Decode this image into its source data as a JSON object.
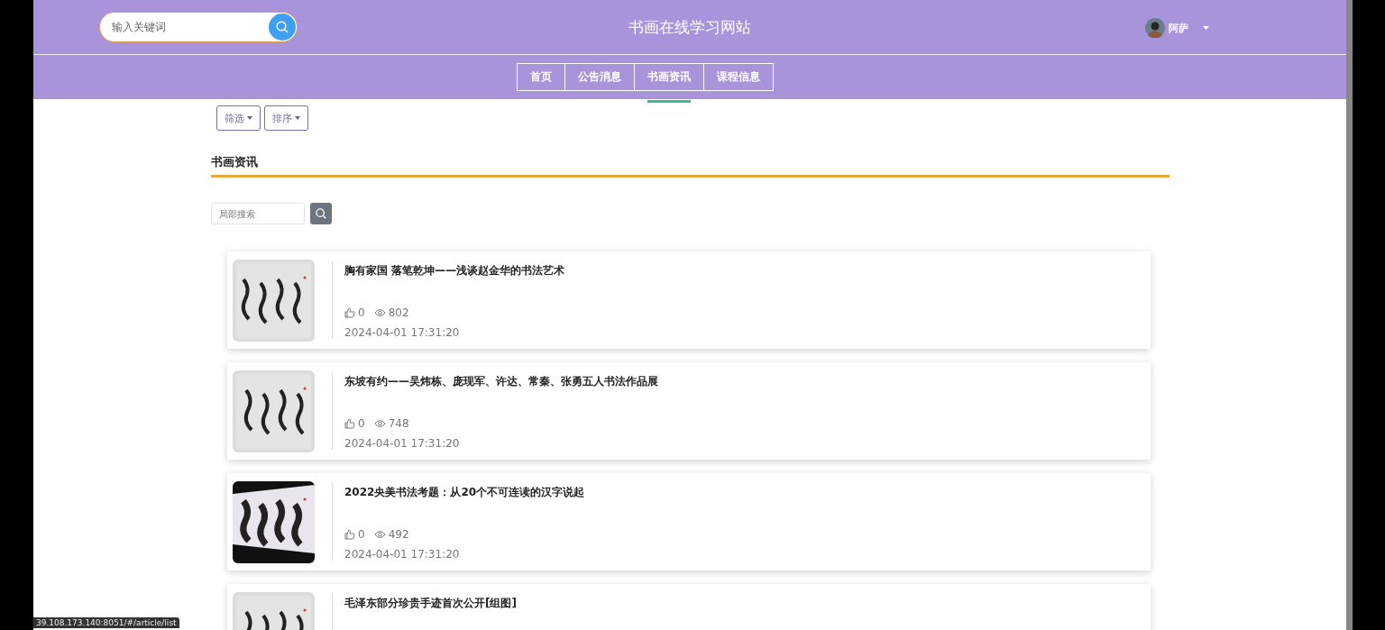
{
  "header": {
    "search": {
      "placeholder": "输入关键词"
    },
    "site_title": "书画在线学习网站",
    "user": {
      "name": "阿萨"
    }
  },
  "nav": {
    "tabs": [
      {
        "label": "首页",
        "selected": false
      },
      {
        "label": "公告消息",
        "selected": false
      },
      {
        "label": "书画资讯",
        "selected": true
      },
      {
        "label": "课程信息",
        "selected": false
      }
    ]
  },
  "toolbar": {
    "buttons": [
      "筛选",
      "排序"
    ]
  },
  "section": {
    "title": "书画资讯",
    "local_search": {
      "placeholder": "局部搜索"
    }
  },
  "articles": [
    {
      "title": "胸有家国 落笔乾坤——浅谈赵金华的书法艺术",
      "likes": "0",
      "views": "802",
      "date": "2024-04-01 17:31:20"
    },
    {
      "title": "东坡有约——吴炜栋、庞现军、许达、常秦、张勇五人书法作品展",
      "likes": "0",
      "views": "748",
      "date": "2024-04-01 17:31:20"
    },
    {
      "title": "2022央美书法考题：从20个不可连读的汉字说起",
      "likes": "0",
      "views": "492",
      "date": "2024-04-01 17:31:20"
    },
    {
      "title": "毛泽东部分珍贵手迹首次公开[组图]"
    }
  ],
  "status_bar": {
    "url": "39.108.173.140:8051/#/article/list"
  }
}
